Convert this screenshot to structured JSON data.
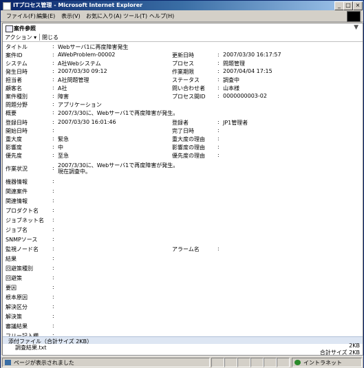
{
  "window": {
    "title": "ITプロセス管理 - Microsoft Internet Explorer",
    "min": "_",
    "max": "□",
    "close": "×"
  },
  "menu": [
    "ファイル(F)",
    "編集(E)",
    "表示(V)",
    "お気に入り(A)",
    "ツール(T)",
    "ヘルプ(H)"
  ],
  "panel": {
    "title": "案件参照",
    "chevron": "▼"
  },
  "toolbar": {
    "action": "アクション ▾",
    "close": "閉じる"
  },
  "fields": {
    "title_label": "タイトル",
    "title": "Webサーバ1に再度障害発生",
    "id_label": "案件ID",
    "id": "AWebProblem-00002",
    "updated_label": "更新日時",
    "updated": "2007/03/30 16:17:57",
    "system_label": "システム",
    "system": "A社Webシステム",
    "process_label": "プロセス",
    "process": "問題管理",
    "occurred_label": "発生日時",
    "occurred": "2007/03/30 09:12",
    "deadline_label": "作業期限",
    "deadline": "2007/04/04 17:15",
    "owner_label": "担当者",
    "owner": "A社問題管理",
    "status_label": "ステータス",
    "status": "調査中",
    "customer_label": "顧客名",
    "customer": "A社",
    "contact_label": "問い合わせ者",
    "contact": "山本様",
    "type_label": "案件種別",
    "type": "障害",
    "processid_label": "プロセス間ID",
    "processid": "0000000003-02",
    "area_label": "問題分野",
    "area": "アプリケーション",
    "summary_label": "概要",
    "summary": "2007/3/30に、Webサーバ1で再度障害が発生。",
    "registered_label": "登録日時",
    "registered": "2007/03/30 16:01:46",
    "registrant_label": "登録者",
    "registrant": "JP1管理者",
    "start_label": "開始日時",
    "end_label": "完了日時",
    "severity_label": "重大度",
    "severity": "緊急",
    "severity_reason_label": "重大度の理由",
    "impact_label": "影響度",
    "impact": "中",
    "impact_reason_label": "影響度の理由",
    "priority_label": "優先度",
    "priority": "至急",
    "priority_reason_label": "優先度の理由",
    "work_label": "作業状況",
    "work_line1": "2007/3/30に、Webサーバ1で再度障害が発生。",
    "work_line2": "現在調査中。",
    "device_label": "機器情報",
    "related_case_label": "関連案件",
    "related_info_label": "関連情報",
    "product_label": "プロダクト名",
    "jobnet_label": "ジョブネット名",
    "job_label": "ジョブ名",
    "snmp_label": "SNMPソース",
    "node_label": "監視ノード名",
    "alarm_label": "アラーム名",
    "result_label": "結果",
    "measure_type_label": "回避策種別",
    "measure_label": "回避策",
    "cause_label": "要因",
    "root_cause_label": "根本原因",
    "resolution_type_label": "解決区分",
    "resolution_label": "解決策",
    "review_label": "審議結果",
    "free_label": "フリー記入欄",
    "colon": ":"
  },
  "attachments": {
    "header": "添付ファイル（合計サイズ 2KB）",
    "file": "調査結果.txt",
    "size": "2KB",
    "total": "合計サイズ 2KB"
  },
  "statusbar": {
    "message": "ページが表示されました",
    "zone": "イントラネット"
  }
}
